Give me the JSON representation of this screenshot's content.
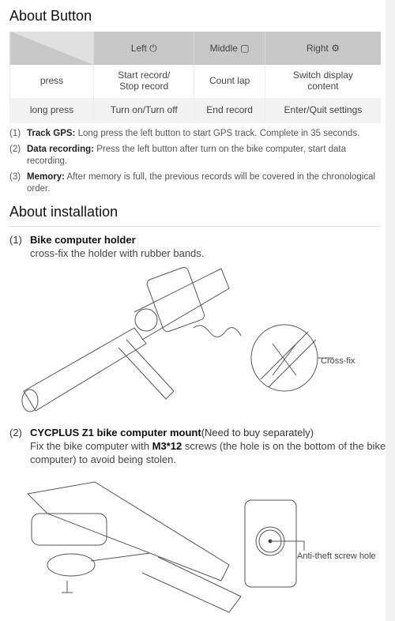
{
  "sections": {
    "button_title": "About Button",
    "install_title": "About installation"
  },
  "table": {
    "headers": [
      {
        "label": "Left",
        "icon": "power-icon"
      },
      {
        "label": "Middle",
        "icon": "square-icon"
      },
      {
        "label": "Right",
        "icon": "gear-icon"
      }
    ],
    "rows": [
      {
        "action": "press",
        "cells": [
          "Start record/\nStop record",
          "Count lap",
          "Switch display\ncontent"
        ]
      },
      {
        "action": "long press",
        "cells": [
          "Turn on/Turn off",
          "End record",
          "Enter/Quit settings"
        ]
      }
    ]
  },
  "notes": [
    {
      "num": "(1)",
      "title": "Track GPS:",
      "text": " Long press the left button to start GPS track. Complete in 35 seconds."
    },
    {
      "num": "(2)",
      "title": "Data recording:",
      "text": " Press the left button after turn on the bike computer, start data recording."
    },
    {
      "num": "(3)",
      "title": "Memory:",
      "text": " After memory is full, the previous records will be covered in the chronological order."
    }
  ],
  "install": {
    "step1": {
      "num": "(1)",
      "title": "Bike computer holder",
      "text": "cross-fix the holder with rubber bands.",
      "callout": "Cross-fix"
    },
    "step2": {
      "num": "(2)",
      "title": "CYCPLUS Z1 bike computer mount",
      "title_suffix": "(Need to buy separately)",
      "text_pre": "Fix the bike computer with ",
      "text_bold": "M3*12",
      "text_post": " screws (the hole is on the bottom of the bike computer) to avoid being stolen.",
      "callout": "Anti-theft screw hole"
    }
  }
}
